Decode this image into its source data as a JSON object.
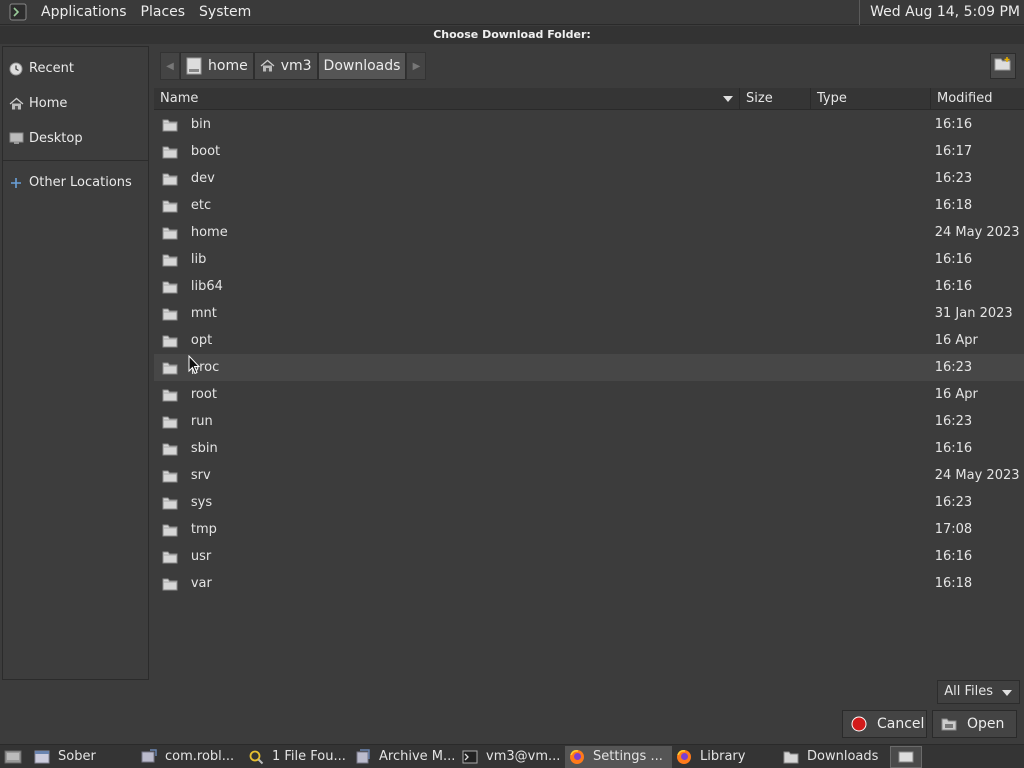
{
  "top_panel": {
    "menus": [
      "Applications",
      "Places",
      "System"
    ],
    "clock": "Wed Aug 14,  5:09 PM"
  },
  "dialog": {
    "title": "Choose Download Folder:"
  },
  "sidebar": {
    "items": [
      {
        "label": "Recent",
        "icon": "clock-icon"
      },
      {
        "label": "Home",
        "icon": "home-icon"
      },
      {
        "label": "Desktop",
        "icon": "desktop-icon"
      },
      {
        "label": "Other Locations",
        "icon": "plus-icon"
      }
    ]
  },
  "pathbar": {
    "segments": [
      "home",
      "vm3",
      "Downloads"
    ]
  },
  "columns": {
    "name": "Name",
    "size": "Size",
    "type": "Type",
    "modified": "Modified"
  },
  "files": [
    {
      "name": "bin",
      "modified": "16:16"
    },
    {
      "name": "boot",
      "modified": "16:17"
    },
    {
      "name": "dev",
      "modified": "16:23"
    },
    {
      "name": "etc",
      "modified": "16:18"
    },
    {
      "name": "home",
      "modified": "24 May 2023"
    },
    {
      "name": "lib",
      "modified": "16:16"
    },
    {
      "name": "lib64",
      "modified": "16:16"
    },
    {
      "name": "mnt",
      "modified": "31 Jan 2023"
    },
    {
      "name": "opt",
      "modified": "16 Apr"
    },
    {
      "name": "proc",
      "modified": "16:23"
    },
    {
      "name": "root",
      "modified": "16 Apr"
    },
    {
      "name": "run",
      "modified": "16:23"
    },
    {
      "name": "sbin",
      "modified": "16:16"
    },
    {
      "name": "srv",
      "modified": "24 May 2023"
    },
    {
      "name": "sys",
      "modified": "16:23"
    },
    {
      "name": "tmp",
      "modified": "17:08"
    },
    {
      "name": "usr",
      "modified": "16:16"
    },
    {
      "name": "var",
      "modified": "16:18"
    }
  ],
  "filter": {
    "label": "All Files"
  },
  "buttons": {
    "cancel": "Cancel",
    "open": "Open"
  },
  "taskbar": {
    "tasks": [
      {
        "label": "Sober",
        "icon": "window-icon"
      },
      {
        "label": "com.robl...",
        "icon": "app-icon"
      },
      {
        "label": "1 File Fou...",
        "icon": "search-icon"
      },
      {
        "label": "Archive M...",
        "icon": "archive-icon"
      },
      {
        "label": "vm3@vm...",
        "icon": "terminal-icon"
      },
      {
        "label": "Settings ...",
        "icon": "firefox-icon"
      },
      {
        "label": "Library",
        "icon": "firefox-icon"
      },
      {
        "label": "Downloads",
        "icon": "folder-icon"
      }
    ]
  },
  "colors": {
    "background": "#3c3c3c",
    "cancel_red": "#d21b1b",
    "firefox_orange": "#ff7a1a"
  }
}
